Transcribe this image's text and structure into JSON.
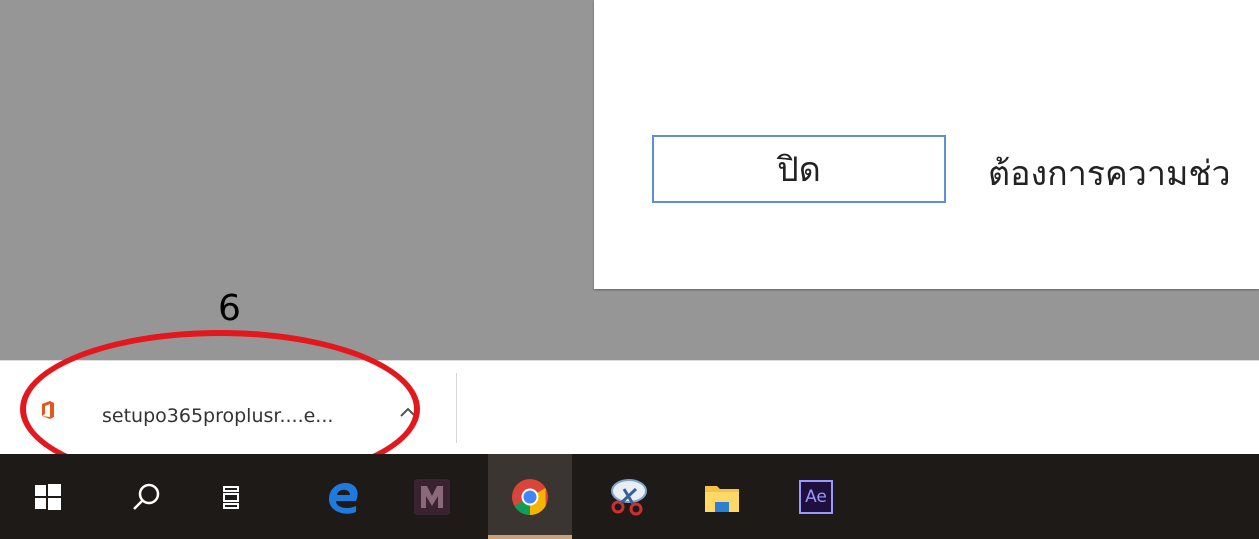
{
  "dialog": {
    "close_label": "ปิด",
    "help_text": "ต้องการความช่ว"
  },
  "downloads": {
    "items": [
      {
        "file_name": "setupo365proplusr....e...",
        "icon": "office-icon"
      }
    ]
  },
  "annotation": {
    "step_number": "6",
    "color": "#e3171c"
  },
  "taskbar": {
    "items": [
      {
        "icon": "windows-start-icon"
      },
      {
        "icon": "search-icon"
      },
      {
        "icon": "task-view-icon"
      },
      {
        "icon": "edge-icon"
      },
      {
        "icon": "predator-sense-icon"
      },
      {
        "icon": "chrome-icon",
        "active": true
      },
      {
        "icon": "snipping-tool-icon"
      },
      {
        "icon": "file-explorer-icon"
      },
      {
        "icon": "after-effects-icon",
        "label": "Ae"
      }
    ]
  },
  "colors": {
    "overlay": "#969696",
    "focus_border": "#5b8fd6",
    "taskbar": "#1e1a18"
  }
}
